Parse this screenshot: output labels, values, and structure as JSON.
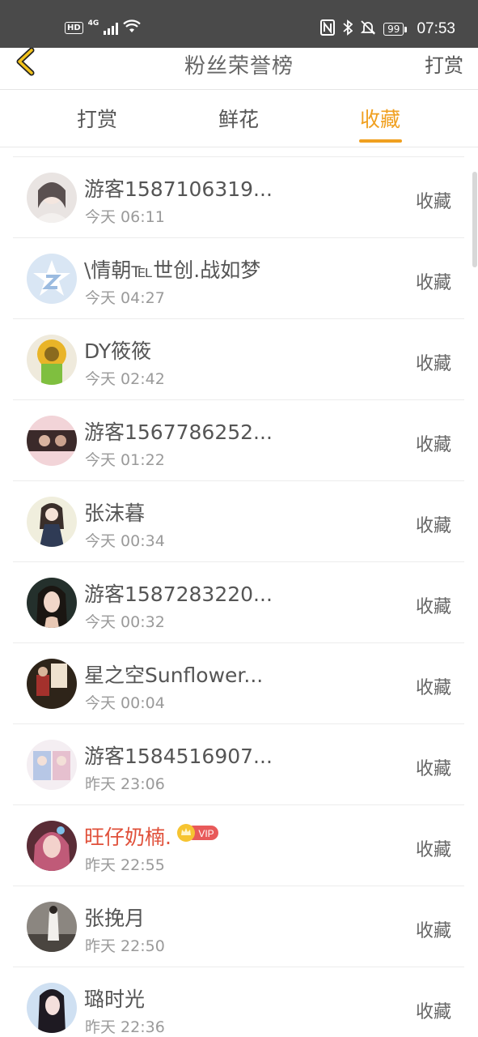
{
  "status_bar": {
    "hd": "HD",
    "network": "4G",
    "battery": "99",
    "time": "07:53"
  },
  "header": {
    "title": "粉丝荣誉榜",
    "action": "打赏"
  },
  "tabs": [
    {
      "label": "打赏",
      "active": false
    },
    {
      "label": "鲜花",
      "active": false
    },
    {
      "label": "收藏",
      "active": true
    }
  ],
  "accent_color": "#f0a020",
  "vip_badge_label": "VIP",
  "list": [
    {
      "name": "游客1587106319...",
      "time": "今天 06:11",
      "action": "收藏"
    },
    {
      "name": "\\情朝℡世创.战如梦",
      "time": "今天 04:27",
      "action": "收藏"
    },
    {
      "name": "DY筱筱",
      "time": "今天 02:42",
      "action": "收藏"
    },
    {
      "name": "游客1567786252...",
      "time": "今天 01:22",
      "action": "收藏"
    },
    {
      "name": "张沫暮",
      "time": "今天 00:34",
      "action": "收藏"
    },
    {
      "name": "游客1587283220...",
      "time": "今天 00:32",
      "action": "收藏"
    },
    {
      "name": "星之空Sunflower...",
      "time": "今天 00:04",
      "action": "收藏"
    },
    {
      "name": "游客1584516907...",
      "time": "昨天 23:06",
      "action": "收藏"
    },
    {
      "name": "旺仔奶楠.",
      "time": "昨天 22:55",
      "action": "收藏",
      "vip": true
    },
    {
      "name": "张挽月",
      "time": "昨天 22:50",
      "action": "收藏"
    },
    {
      "name": "璐时光",
      "time": "昨天 22:36",
      "action": "收藏"
    }
  ]
}
